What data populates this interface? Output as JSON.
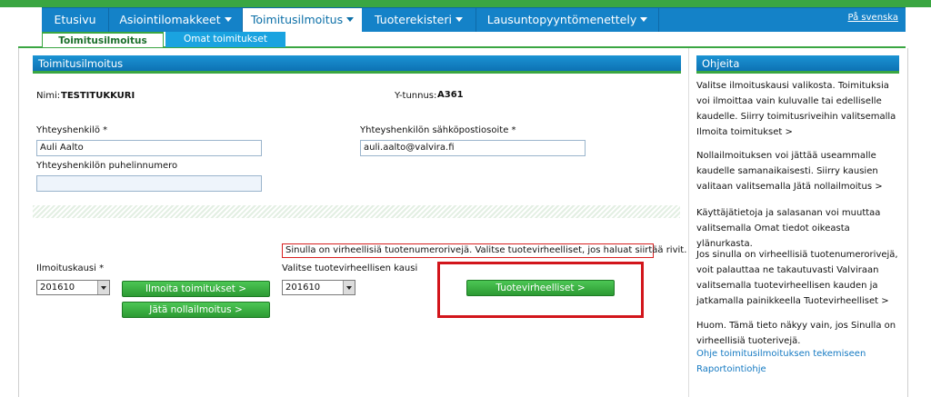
{
  "nav": {
    "items": [
      {
        "label": "Etusivu",
        "caret": false
      },
      {
        "label": "Asiointilomakkeet",
        "caret": true
      },
      {
        "label": "Toimitusilmoitus",
        "caret": true,
        "active": true
      },
      {
        "label": "Tuoterekisteri",
        "caret": true
      },
      {
        "label": "Lausuntopyyntömenettely",
        "caret": true
      }
    ],
    "language_link": "På svenska"
  },
  "subnav": {
    "active": "Toimitusilmoitus",
    "inactive": "Omat toimitukset"
  },
  "form": {
    "header": "Toimitusilmoitus",
    "name_label": "Nimi:",
    "name_value": "TESTITUKKURI",
    "ytunnus_label": "Y-tunnus:",
    "ytunnus_value": "A361",
    "contact_label": "Yhteyshenkilö *",
    "contact_value": "Auli Aalto",
    "email_label": "Yhteyshenkilön sähköpostiosoite *",
    "email_value": "auli.aalto@valvira.fi",
    "phone_label": "Yhteyshenkilön puhelinnumero",
    "phone_value": "",
    "error_message": "Sinulla on virheellisiä tuotenumerorivejä. Valitse tuotevirheelliset, jos haluat siirtää rivit.",
    "period_label": "Ilmoituskausi *",
    "period_value": "201610",
    "report_button": "Ilmoita toimitukset >",
    "nil_button": "Jätä nollailmoitus >",
    "fault_period_label": "Valitse tuotevirheellisen kausi",
    "fault_period_value": "201610",
    "faults_button": "Tuotevirheelliset >"
  },
  "help": {
    "header": "Ohjeita",
    "paragraphs": [
      "Valitse ilmoituskausi valikosta. Toimituksia voi ilmoittaa vain kuluvalle tai edelliselle kaudelle. Siirry toimitusriveihin valitsemalla Ilmoita toimitukset >",
      "Nollailmoituksen voi jättää useammalle kaudelle samanaikaisesti. Siirry kausien valitaan valitsemalla Jätä nollailmoitus >",
      "Käyttäjätietoja ja salasanan voi muuttaa valitsemalla Omat tiedot oikeasta ylänurkasta.",
      "Jos sinulla on virheellisiä tuotenumerorivejä, voit palauttaa ne takautuvasti Valviraan valitsemalla tuotevirheellisen kauden ja jatkamalla painikkeella Tuotevirheelliset >",
      "Huom. Tämä tieto näkyy vain, jos Sinulla on virheellisiä tuoterivejä."
    ],
    "links": [
      "Ohje toimitusilmoituksen tekemiseen",
      "Raportointiohje"
    ]
  },
  "colors": {
    "brand_green": "#3aa642",
    "nav_blue": "#1482c8",
    "button_green": "#2c9a33",
    "highlight_red": "#d2151b"
  }
}
